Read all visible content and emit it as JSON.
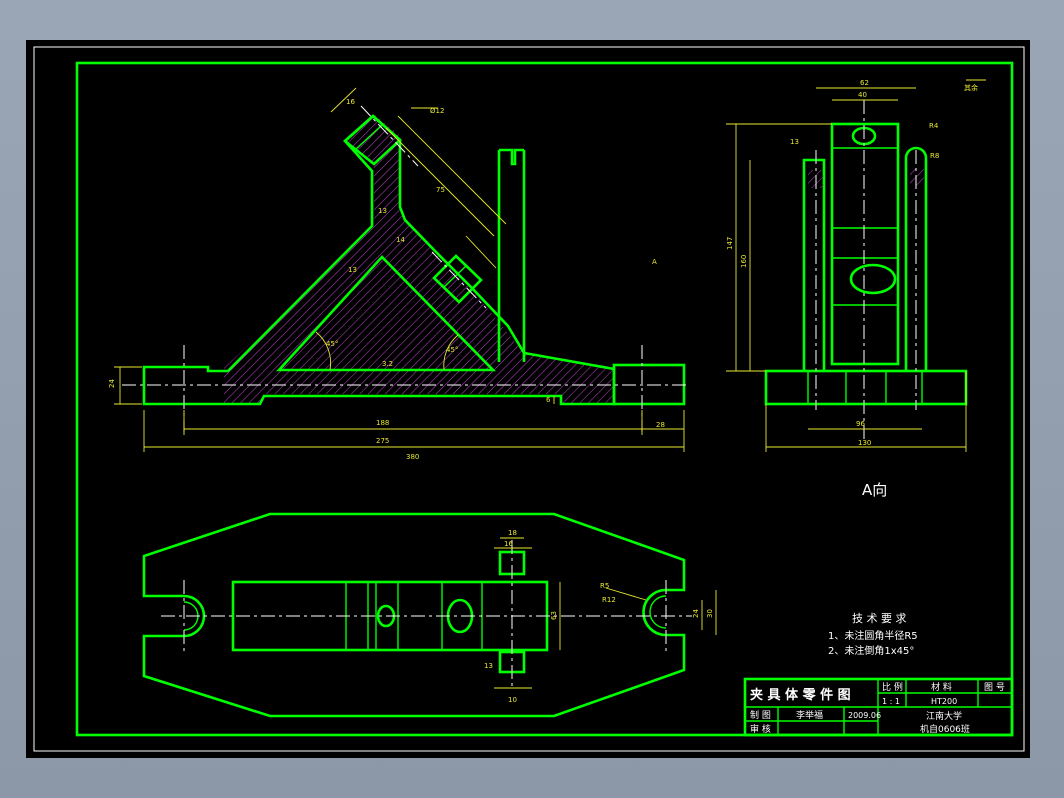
{
  "title_block": {
    "drawing_name": "夹 具 体 零 件 图",
    "scale_label": "比 例",
    "scale_value": "1 : 1",
    "material_label": "材 料",
    "material_value": "HT200",
    "drawing_no_label": "图 号",
    "drafter_label": "制 图",
    "drafter_name": "李举福",
    "date": "2009.06",
    "checker_label": "审 核",
    "school": "江南大学",
    "class": "机自0606班"
  },
  "technical_requirements": {
    "heading": "技 术 要 求",
    "items": [
      "1、未注圆角半径R5",
      "2、未注倒角1x45°"
    ]
  },
  "view_labels": {
    "view_a": "A向",
    "surface_roughness_note": "其余",
    "a_arrow": "A"
  },
  "dimensions": {
    "front": [
      "16",
      "17",
      "8",
      "Ø12",
      "75",
      "45°",
      "13",
      "13",
      "13",
      "14",
      "45°",
      "45°",
      "15",
      "5",
      "188",
      "275",
      "380",
      "28",
      "24",
      "6"
    ],
    "side": [
      "62",
      "40",
      "13",
      "7",
      "8",
      "R8",
      "R4",
      "147",
      "160",
      "96",
      "130"
    ],
    "top": [
      "18",
      "16",
      "8",
      "63",
      "R5",
      "R12",
      "24",
      "30",
      "13",
      "13",
      "10"
    ]
  },
  "colors": {
    "outline": "#00ff00",
    "centerline": "#ffffff",
    "dimension": "#e8e830",
    "hatch": "#b040c0",
    "background": "#000000",
    "frame": "#9aa6b6"
  }
}
